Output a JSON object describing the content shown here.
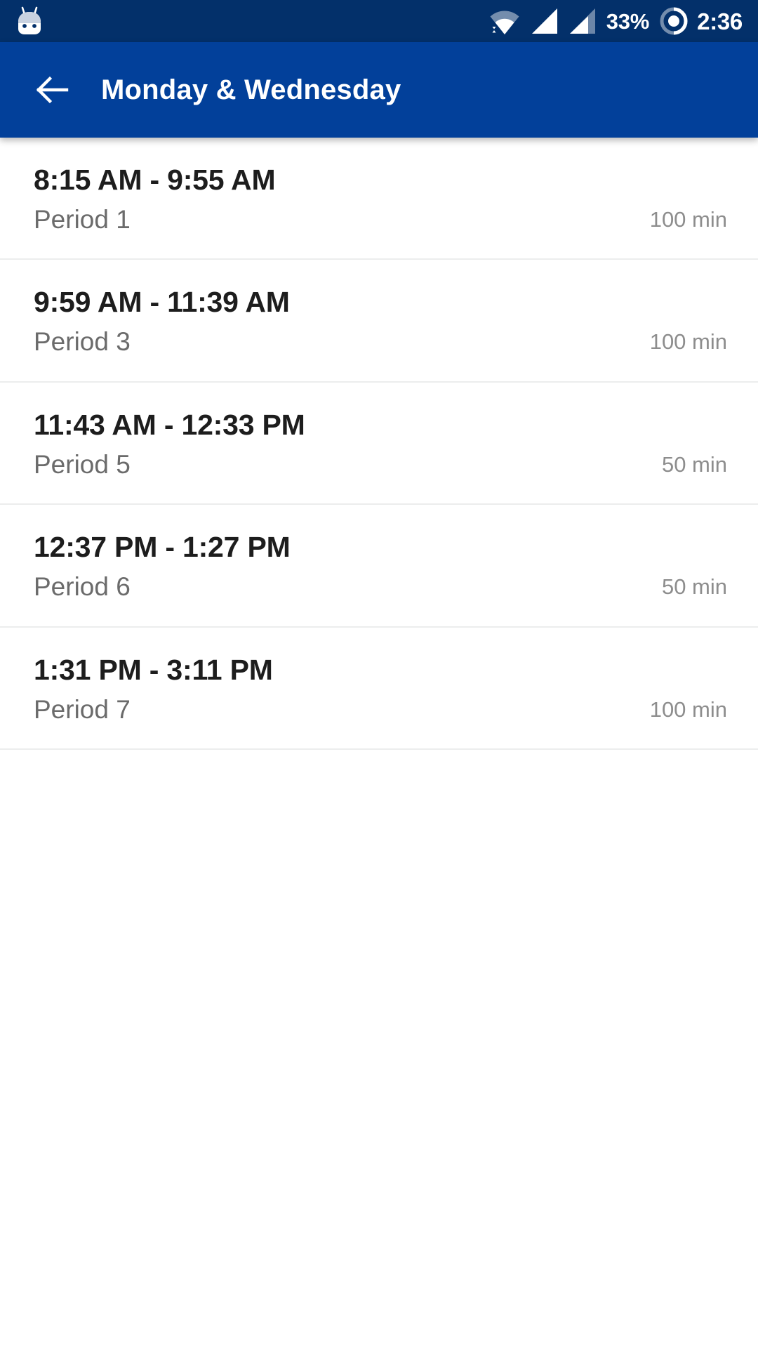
{
  "status_bar": {
    "notification_icon": "android-mascot-icon",
    "wifi_icon": "wifi-icon",
    "signal_icon_1": "signal-bars-icon",
    "signal_icon_2": "signal-bars-icon",
    "battery_percent": "33%",
    "battery_icon": "battery-circle-icon",
    "clock": "2:36",
    "background_color": "#03306a",
    "foreground_color": "#ffffff"
  },
  "app_bar": {
    "back_icon": "arrow-left-icon",
    "title": "Monday & Wednesday",
    "background_color": "#02409a",
    "foreground_color": "#ffffff"
  },
  "schedule": {
    "divider_color": "#eceded",
    "time_color": "#1d1d1d",
    "label_color": "#6b6b6b",
    "duration_color": "#8d8d8d",
    "items": [
      {
        "time": "8:15 AM - 9:55 AM",
        "label": "Period 1",
        "duration": "100 min"
      },
      {
        "time": "9:59 AM - 11:39 AM",
        "label": "Period 3",
        "duration": "100 min"
      },
      {
        "time": "11:43 AM - 12:33 PM",
        "label": "Period 5",
        "duration": "50 min"
      },
      {
        "time": "12:37 PM - 1:27 PM",
        "label": "Period 6",
        "duration": "50 min"
      },
      {
        "time": "1:31 PM - 3:11 PM",
        "label": "Period 7",
        "duration": "100 min"
      }
    ]
  }
}
